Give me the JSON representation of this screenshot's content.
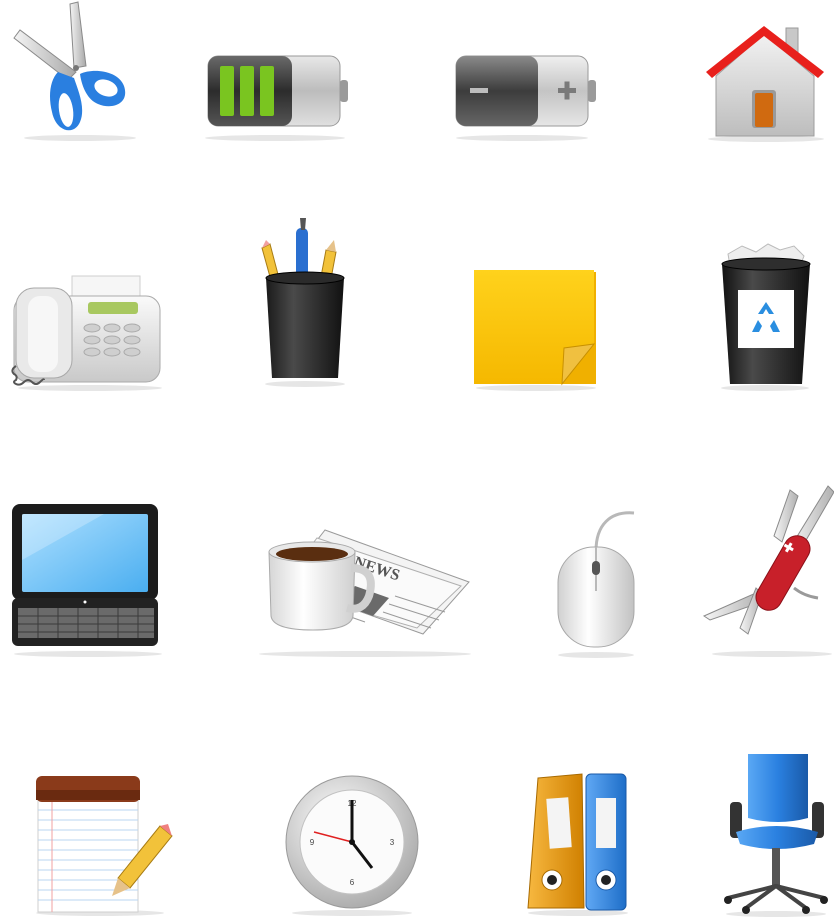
{
  "icons": [
    {
      "name": "scissors-icon"
    },
    {
      "name": "battery-charging-icon"
    },
    {
      "name": "battery-icon"
    },
    {
      "name": "home-icon"
    },
    {
      "name": "fax-machine-icon"
    },
    {
      "name": "pencil-cup-icon"
    },
    {
      "name": "sticky-note-icon"
    },
    {
      "name": "recycle-bin-icon"
    },
    {
      "name": "laptop-icon"
    },
    {
      "name": "coffee-newspaper-icon",
      "text": "NEWS"
    },
    {
      "name": "mouse-icon"
    },
    {
      "name": "pocket-knife-icon"
    },
    {
      "name": "notepad-pencil-icon"
    },
    {
      "name": "clock-icon",
      "text": [
        "12",
        "3",
        "6",
        "9"
      ]
    },
    {
      "name": "binders-icon"
    },
    {
      "name": "office-chair-icon"
    }
  ],
  "colors": {
    "scissors_blue": "#2a7fe0",
    "battery_green": "#7ac520",
    "roof_red": "#e8201c",
    "door_orange": "#d06a10",
    "note_yellow": "#ffcf1a",
    "recycle_blue": "#2a8ee0",
    "knife_red": "#c8202a",
    "binder_orange": "#f0a020",
    "binder_blue": "#3a8ee6",
    "chair_blue": "#2a80e0",
    "shadow_gray": "#e6e6e6"
  }
}
